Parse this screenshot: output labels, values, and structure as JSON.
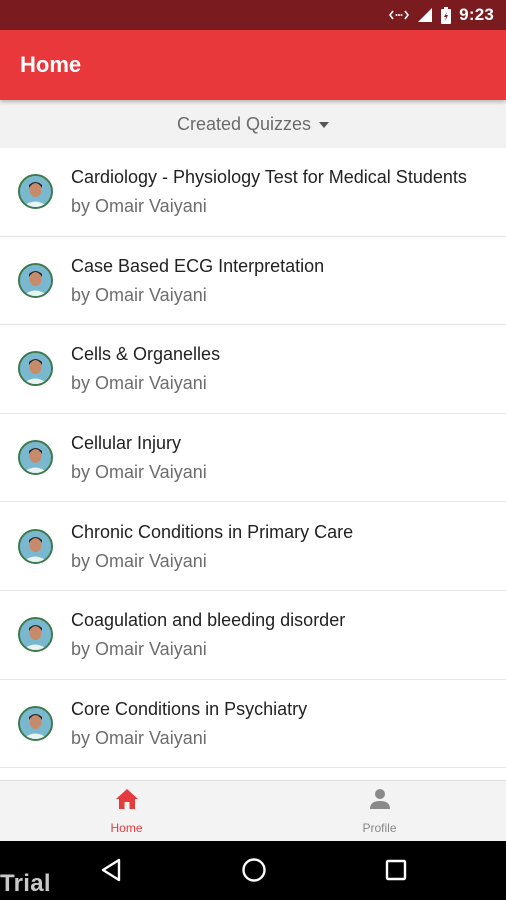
{
  "status_bar": {
    "time": "9:23",
    "icons": [
      "data-transfer-icon",
      "signal-icon",
      "battery-icon"
    ]
  },
  "app_bar": {
    "title": "Home"
  },
  "filter": {
    "label": "Created Quizzes"
  },
  "quizzes": [
    {
      "title": "Cardiology - Physiology Test for Medical Students",
      "author": "by Omair Vaiyani"
    },
    {
      "title": "Case Based ECG Interpretation",
      "author": "by Omair Vaiyani"
    },
    {
      "title": "Cells & Organelles",
      "author": "by Omair Vaiyani"
    },
    {
      "title": "Cellular Injury",
      "author": "by Omair Vaiyani"
    },
    {
      "title": "Chronic Conditions in Primary Care",
      "author": "by Omair Vaiyani"
    },
    {
      "title": "Coagulation and bleeding disorder",
      "author": "by Omair Vaiyani"
    },
    {
      "title": "Core Conditions in Psychiatry",
      "author": "by Omair Vaiyani"
    }
  ],
  "bottom_nav": {
    "items": [
      {
        "label": "Home",
        "icon": "home-icon",
        "active": true
      },
      {
        "label": "Profile",
        "icon": "person-icon",
        "active": false
      }
    ]
  },
  "system_nav": {
    "watermark": "Trial",
    "buttons": [
      "back-icon",
      "home-circle-icon",
      "recents-icon"
    ]
  },
  "colors": {
    "status_bar": "#7a1c1f",
    "app_bar": "#e8383c",
    "active": "#e53a3e",
    "inactive": "#8a8a8a"
  }
}
